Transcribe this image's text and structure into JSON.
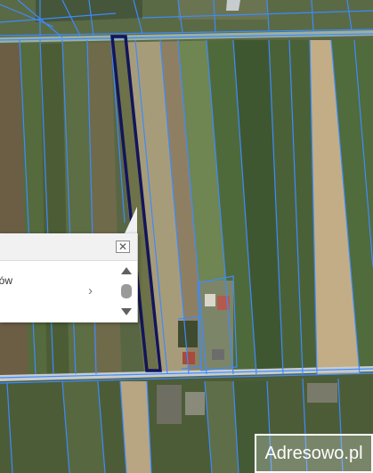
{
  "map": {
    "parcel_line_color": "#3d8bff",
    "selected_parcel_color": "#13155a",
    "road_color": "#c7ccd0"
  },
  "popup": {
    "item_text": "nków",
    "chevron": "›",
    "close_icon": "close-icon"
  },
  "watermark": {
    "text": "Adresowo.pl"
  }
}
